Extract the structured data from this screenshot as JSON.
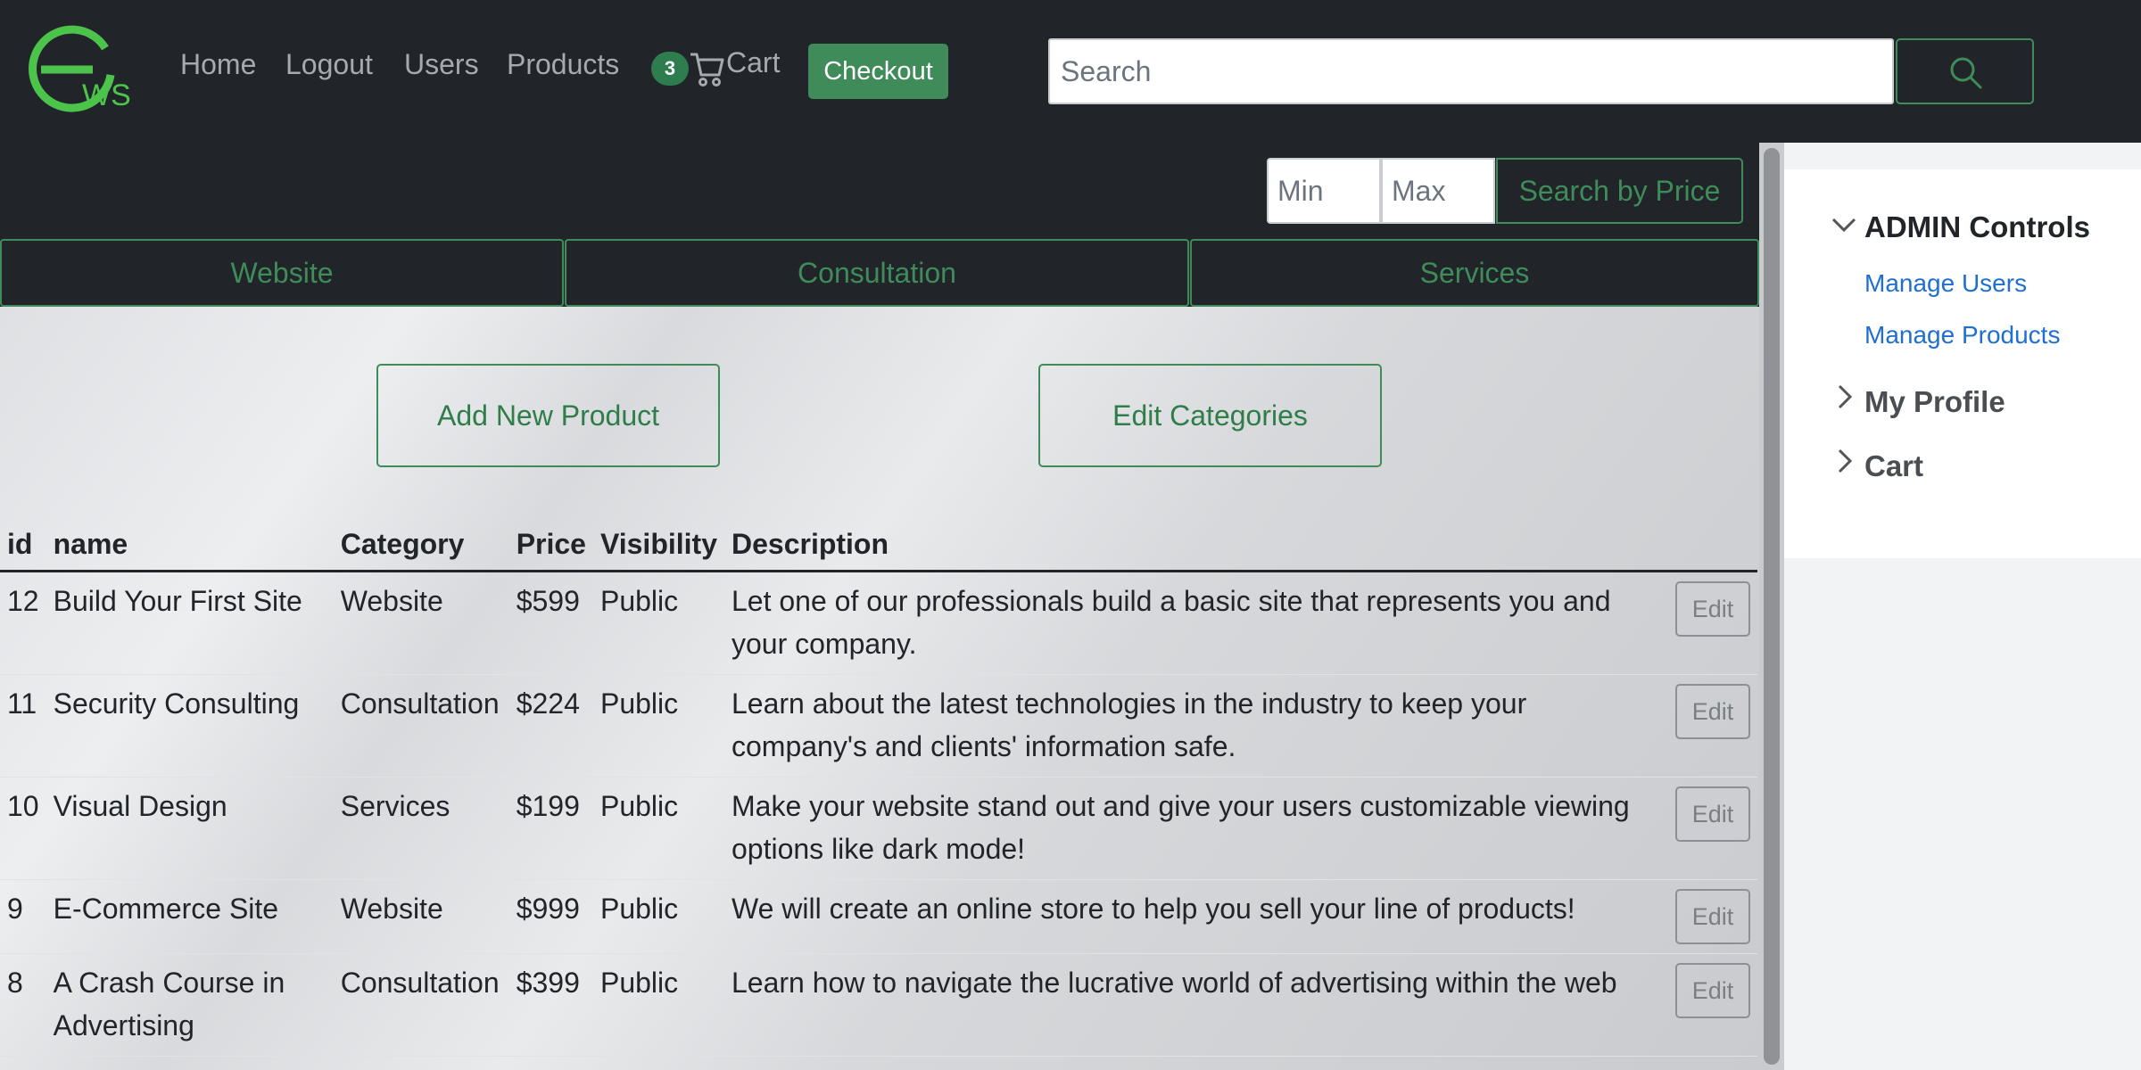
{
  "brand": {
    "logo_text": "WS",
    "accent": "#3f8c5a",
    "logo_green": "#4cc44c"
  },
  "nav": {
    "links": [
      "Home",
      "Logout",
      "Users",
      "Products"
    ],
    "cart_count": "3",
    "cart_label": "Cart",
    "checkout_label": "Checkout",
    "search_placeholder": "Search"
  },
  "price_filter": {
    "min_placeholder": "Min",
    "max_placeholder": "Max",
    "button_label": "Search by Price"
  },
  "categories": [
    "Website",
    "Consultation",
    "Services"
  ],
  "actions": {
    "add_product": "Add New Product",
    "edit_categories": "Edit Categories"
  },
  "table": {
    "headers": [
      "id",
      "name",
      "Category",
      "Price",
      "Visibility",
      "Description"
    ],
    "edit_label": "Edit",
    "rows": [
      {
        "id": "12",
        "name": "Build Your First Site",
        "category": "Website",
        "price": "$599",
        "visibility": "Public",
        "description": "Let one of our professionals build a basic site that represents you and your company."
      },
      {
        "id": "11",
        "name": "Security Consulting",
        "category": "Consultation",
        "price": "$224",
        "visibility": "Public",
        "description": "Learn about the latest technologies in the industry to keep your company's and clients' information safe."
      },
      {
        "id": "10",
        "name": "Visual Design",
        "category": "Services",
        "price": "$199",
        "visibility": "Public",
        "description": "Make your website stand out and give your users customizable viewing options like dark mode!"
      },
      {
        "id": "9",
        "name": "E-Commerce Site",
        "category": "Website",
        "price": "$999",
        "visibility": "Public",
        "description": "We will create an online store to help you sell your line of products!"
      },
      {
        "id": "8",
        "name": "A Crash Course in Advertising",
        "category": "Consultation",
        "price": "$399",
        "visibility": "Public",
        "description": "Learn how to navigate the lucrative world of advertising within the web"
      }
    ]
  },
  "sidebar": {
    "admin": {
      "title": "ADMIN Controls",
      "links": [
        "Manage Users",
        "Manage Products"
      ]
    },
    "profile": "My Profile",
    "cart": "Cart"
  }
}
